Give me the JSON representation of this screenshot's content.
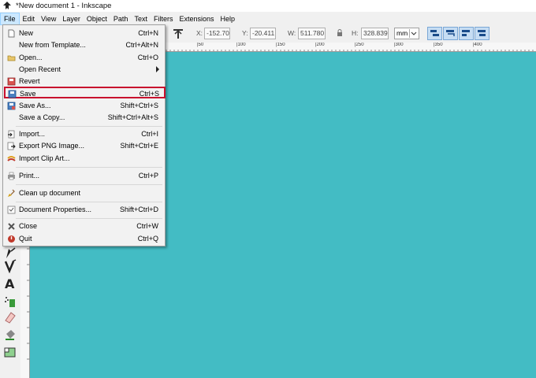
{
  "window": {
    "title": "*New document 1 - Inkscape"
  },
  "menubar": {
    "file": "File",
    "edit": "Edit",
    "view": "View",
    "layer": "Layer",
    "object": "Object",
    "path": "Path",
    "text": "Text",
    "filters": "Filters",
    "extensions": "Extensions",
    "help": "Help"
  },
  "toolbar": {
    "x_label": "X:",
    "x_value": "-152.70",
    "y_label": "Y:",
    "y_value": "-20.411",
    "w_label": "W:",
    "w_value": "511.780",
    "h_label": "H:",
    "h_value": "328.839",
    "unit": "mm"
  },
  "ruler": {
    "ticks": [
      "|50",
      "|100",
      "|150",
      "|200",
      "|250",
      "|300",
      "|350",
      "|400"
    ]
  },
  "file_menu": {
    "new": {
      "label": "New",
      "shortcut": "Ctrl+N"
    },
    "new_from_template": {
      "label": "New from Template...",
      "shortcut": "Ctrl+Alt+N"
    },
    "open": {
      "label": "Open...",
      "shortcut": "Ctrl+O"
    },
    "open_recent": {
      "label": "Open Recent"
    },
    "revert": {
      "label": "Revert"
    },
    "save": {
      "label": "Save",
      "shortcut": "Ctrl+S"
    },
    "save_as": {
      "label": "Save As...",
      "shortcut": "Shift+Ctrl+S"
    },
    "save_copy": {
      "label": "Save a Copy...",
      "shortcut": "Shift+Ctrl+Alt+S"
    },
    "import": {
      "label": "Import...",
      "shortcut": "Ctrl+I"
    },
    "export_png": {
      "label": "Export PNG Image...",
      "shortcut": "Shift+Ctrl+E"
    },
    "import_clip_art": {
      "label": "Import Clip Art..."
    },
    "print": {
      "label": "Print...",
      "shortcut": "Ctrl+P"
    },
    "clean_up": {
      "label": "Clean up document"
    },
    "doc_props": {
      "label": "Document Properties...",
      "shortcut": "Shift+Ctrl+D"
    },
    "close": {
      "label": "Close",
      "shortcut": "Ctrl+W"
    },
    "quit": {
      "label": "Quit",
      "shortcut": "Ctrl+Q"
    }
  },
  "colors": {
    "canvas": "#43bcc4",
    "highlight_border": "#c8102e",
    "menu_active": "#cce8ff"
  }
}
